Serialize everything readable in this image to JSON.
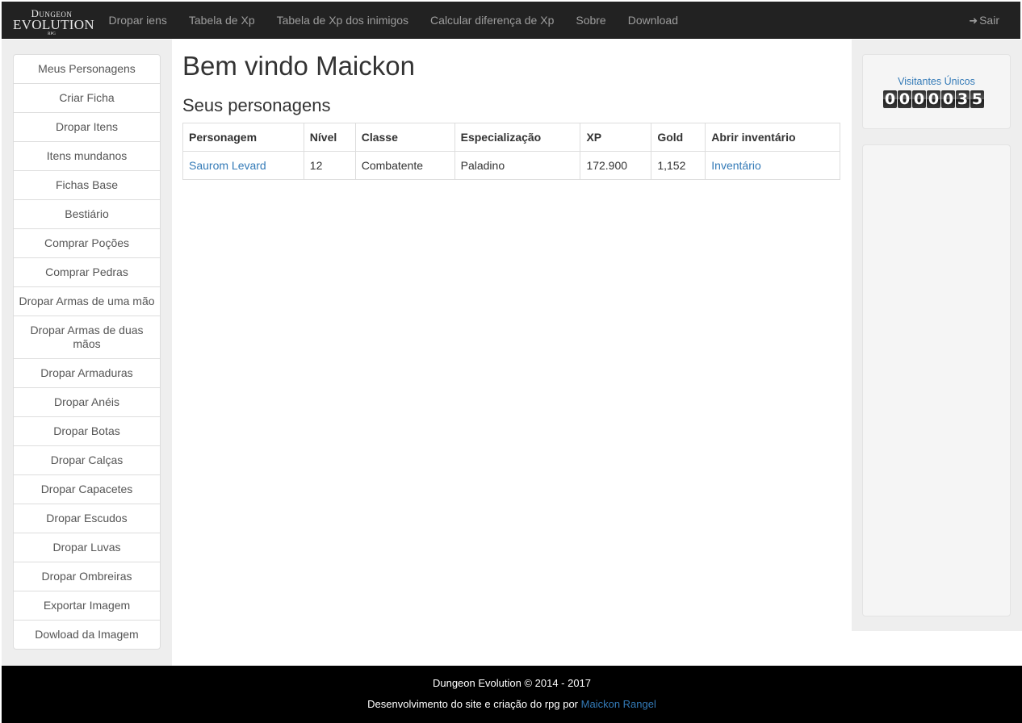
{
  "brand": {
    "line1": "Dungeon",
    "line2": "EVOLUTION",
    "line3": "RPG"
  },
  "nav": {
    "links": [
      "Dropar iens",
      "Tabela de Xp",
      "Tabela de Xp dos inimigos",
      "Calcular diferença de Xp",
      "Sobre",
      "Download"
    ],
    "logout_icon": "sign-out-icon",
    "logout_label": "Sair"
  },
  "sidebar": {
    "items": [
      "Meus Personagens",
      "Criar Ficha",
      "Dropar Itens",
      "Itens mundanos",
      "Fichas Base",
      "Bestiário",
      "Comprar Poções",
      "Comprar Pedras",
      "Dropar Armas de uma mão",
      "Dropar Armas de duas mãos",
      "Dropar Armaduras",
      "Dropar Anéis",
      "Dropar Botas",
      "Dropar Calças",
      "Dropar Capacetes",
      "Dropar Escudos",
      "Dropar Luvas",
      "Dropar Ombreiras",
      "Exportar Imagem",
      "Dowload da Imagem"
    ]
  },
  "main": {
    "title": "Bem vindo Maickon",
    "subtitle": "Seus personagens",
    "table": {
      "headers": [
        "Personagem",
        "Nível",
        "Classe",
        "Especialização",
        "XP",
        "Gold",
        "Abrir inventário"
      ],
      "rows": [
        [
          "Saurom Levard",
          "12",
          "Combatente",
          "Paladino",
          "172.900",
          "1,152",
          "Inventário"
        ]
      ]
    }
  },
  "visitors": {
    "label": "Visitantes Únicos",
    "digits": [
      "0",
      "0",
      "0",
      "0",
      "0",
      "3",
      "5"
    ]
  },
  "footer": {
    "line1": "Dungeon Evolution © 2014 - 2017",
    "line2_prefix": "Desenvolvimento do site e criação do rpg por",
    "author": "Maickon Rangel"
  },
  "colors": {
    "navbar": "#222222",
    "link": "#337ab7",
    "footer": "#000000",
    "panel": "#eeeeee"
  }
}
